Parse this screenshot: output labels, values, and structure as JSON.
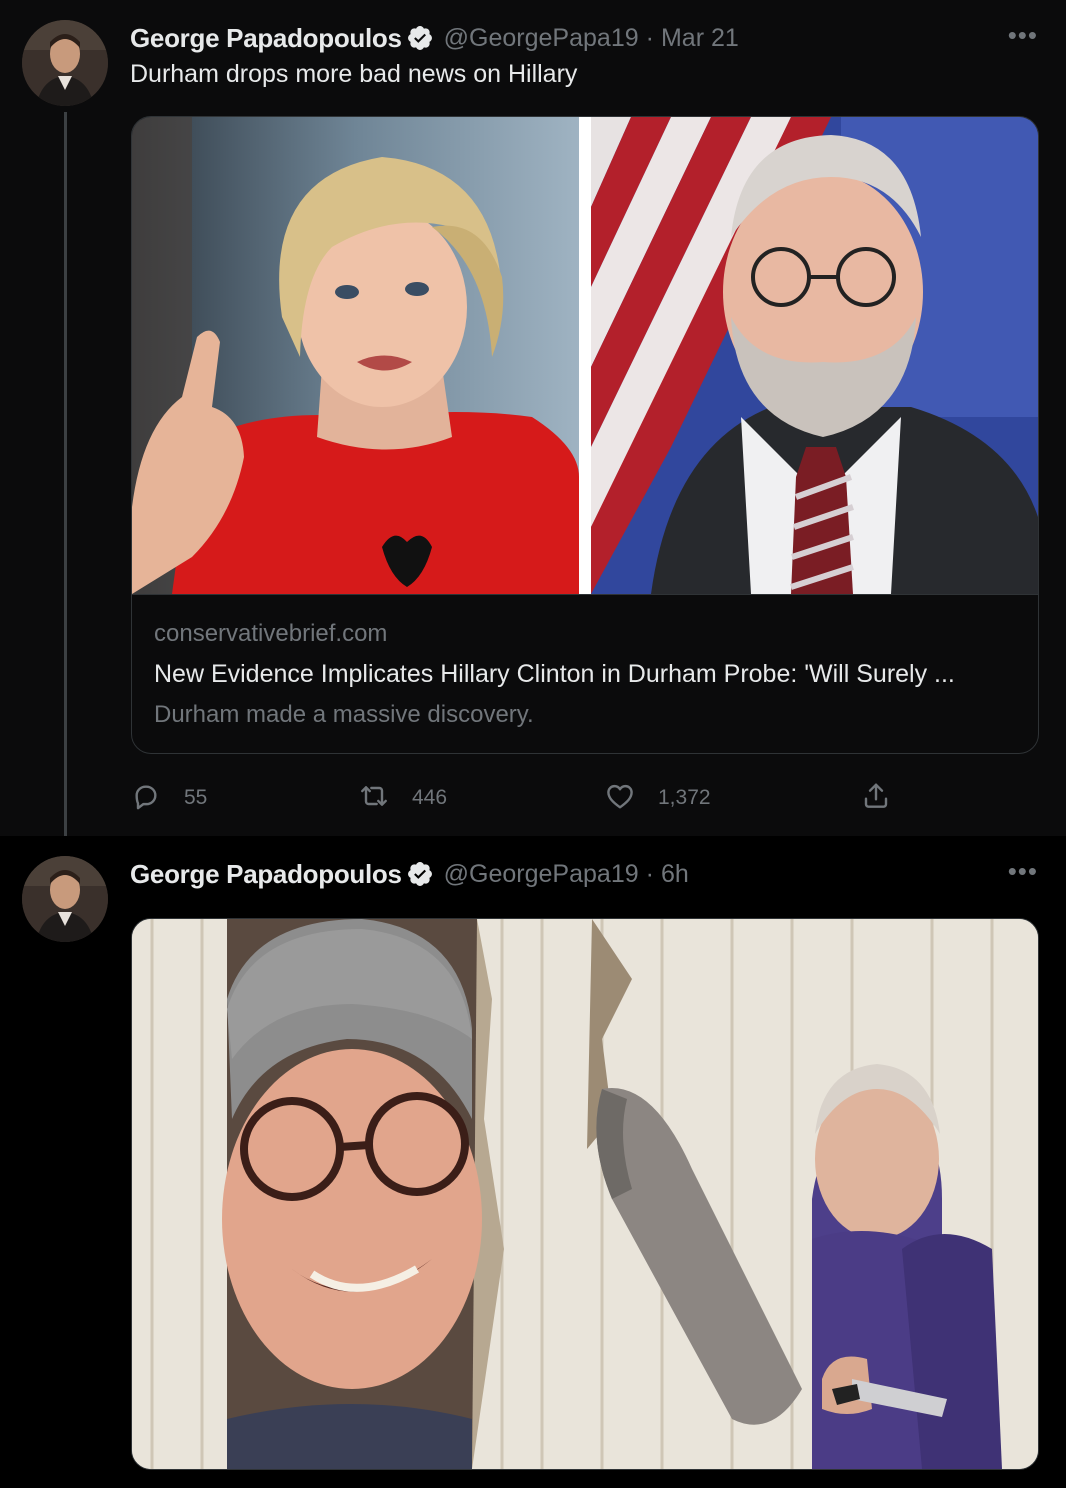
{
  "tweets": [
    {
      "author": {
        "name": "George Papadopoulos",
        "handle": "@GeorgePapa19",
        "verified": true
      },
      "time": "Mar 21",
      "separator": "·",
      "text": "Durham drops more bad news on Hillary",
      "more_icon": "more-icon",
      "card": {
        "domain": "conservativebrief.com",
        "title": "New Evidence Implicates Hillary Clinton in Durham Probe: 'Will Surely ...",
        "description": "Durham made a massive discovery."
      },
      "actions": {
        "replies": "55",
        "retweets": "446",
        "likes": "1,372"
      }
    },
    {
      "author": {
        "name": "George Papadopoulos",
        "handle": "@GeorgePapa19",
        "verified": true
      },
      "time": "6h",
      "separator": "·",
      "more_icon": "more-icon"
    }
  ],
  "colors": {
    "background": "#000000",
    "tweet_bg": "#0b0b0c",
    "text_primary": "#e7e9ea",
    "text_secondary": "#71767b",
    "border": "#2f3336"
  },
  "icons": [
    "verified-badge-icon",
    "reply-icon",
    "retweet-icon",
    "like-icon",
    "share-icon",
    "more-icon"
  ]
}
